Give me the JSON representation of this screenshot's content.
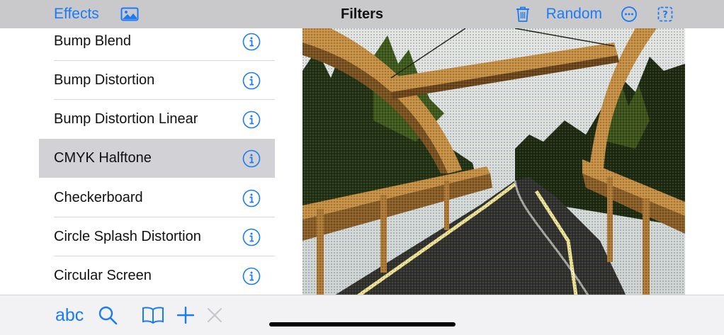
{
  "navbar": {
    "effects_label": "Effects",
    "title": "Filters",
    "random_label": "Random",
    "icons": [
      "image-icon",
      "trash-icon",
      "ellipsis-circle-icon",
      "question-square-icon"
    ]
  },
  "filters": [
    {
      "label": "Bump Blend",
      "selected": false
    },
    {
      "label": "Bump Distortion",
      "selected": false
    },
    {
      "label": "Bump Distortion Linear",
      "selected": false
    },
    {
      "label": "CMYK Halftone",
      "selected": true
    },
    {
      "label": "Checkerboard",
      "selected": false
    },
    {
      "label": "Circle Splash Distortion",
      "selected": false
    },
    {
      "label": "Circular Screen",
      "selected": false
    }
  ],
  "toolbar": {
    "abc_label": "abc",
    "icons": [
      "search-icon",
      "book-icon",
      "plus-icon",
      "close-icon"
    ]
  },
  "colors": {
    "accent": "#1a7bf5",
    "nav_bg": "#c9c9cc",
    "selected_row": "#d1d1d6",
    "disabled": "#c7c7cc"
  }
}
